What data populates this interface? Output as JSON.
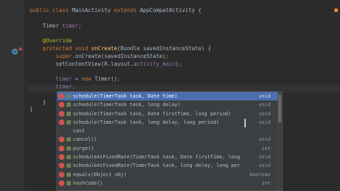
{
  "editor": {
    "lines": [
      {
        "segments": [
          {
            "text": "public class ",
            "cls": "kw"
          },
          {
            "text": "MainActivity ",
            "cls": ""
          },
          {
            "text": "extends ",
            "cls": "kw"
          },
          {
            "text": "AppCompatActivity {",
            "cls": ""
          }
        ]
      },
      {
        "segments": []
      },
      {
        "segments": [
          {
            "text": "    Timer ",
            "cls": ""
          },
          {
            "text": "timer",
            "cls": "fld"
          },
          {
            "text": ";",
            "cls": "kw"
          }
        ]
      },
      {
        "segments": []
      },
      {
        "segments": [
          {
            "text": "    @Override",
            "cls": "ann"
          }
        ]
      },
      {
        "segments": [
          {
            "text": "    protected void ",
            "cls": "kw"
          },
          {
            "text": "onCreate",
            "cls": "method"
          },
          {
            "text": "(Bundle savedInstanceState) {",
            "cls": ""
          }
        ]
      },
      {
        "segments": [
          {
            "text": "        ",
            "cls": ""
          },
          {
            "text": "super",
            "cls": "kw"
          },
          {
            "text": ".onCreate(savedInstanceState)",
            "cls": ""
          },
          {
            "text": ";",
            "cls": "kw"
          }
        ]
      },
      {
        "segments": [
          {
            "text": "        setContentView(R.layout.",
            "cls": ""
          },
          {
            "text": "activity_main",
            "cls": "ital"
          },
          {
            "text": ")",
            "cls": ""
          },
          {
            "text": ";",
            "cls": "kw"
          }
        ]
      },
      {
        "segments": []
      },
      {
        "segments": [
          {
            "text": "        ",
            "cls": ""
          },
          {
            "text": "timer ",
            "cls": "fld"
          },
          {
            "text": "= ",
            "cls": ""
          },
          {
            "text": "new ",
            "cls": "kw"
          },
          {
            "text": "Timer()",
            "cls": ""
          },
          {
            "text": ";",
            "cls": "kw"
          }
        ]
      },
      {
        "segments": [
          {
            "text": "        ",
            "cls": ""
          },
          {
            "text": "timer",
            "cls": "fld"
          },
          {
            "text": ".",
            "cls": ""
          }
        ]
      },
      {
        "segments": []
      },
      {
        "segments": [
          {
            "text": "    }",
            "cls": ""
          }
        ]
      },
      {
        "segments": [
          {
            "text": "}",
            "cls": ""
          }
        ]
      }
    ]
  },
  "completion": {
    "items": [
      {
        "label": "schedule(TimerTask task, Date time)",
        "type": "void",
        "icon": "method-icon"
      },
      {
        "label": "schedule(TimerTask task, long delay)",
        "type": "void",
        "icon": "method-icon"
      },
      {
        "label": "schedule(TimerTask task, Date firstTime, long period)",
        "type": "void",
        "icon": "method-icon"
      },
      {
        "label": "schedule(TimerTask task, long delay, long period)",
        "type": "void",
        "icon": "method-icon"
      },
      {
        "label": "cast",
        "type": "",
        "icon": ""
      },
      {
        "label": "cancel()",
        "type": "void",
        "icon": "method-icon"
      },
      {
        "label": "purge()",
        "type": "int",
        "icon": "method-icon"
      },
      {
        "label": "scheduleAtFixedRate(TimerTask task, Date firstTime, long",
        "type": "void",
        "icon": "method-icon"
      },
      {
        "label": "scheduleAtFixedRate(TimerTask task, long delay, long per",
        "type": "void",
        "icon": "method-icon"
      },
      {
        "label": "equals(Object obj)",
        "type": "boolean",
        "icon": "method-icon"
      },
      {
        "label": "hashCode()",
        "type": "int",
        "icon": "method-icon"
      }
    ],
    "selected_index": 0
  },
  "colors": {
    "background": "#2b2b2b",
    "keyword": "#cc7832",
    "annotation": "#bbb529",
    "field": "#9876aa",
    "method": "#ffc66d",
    "selection": "#4b6eaf",
    "method_icon": "#d25252"
  }
}
